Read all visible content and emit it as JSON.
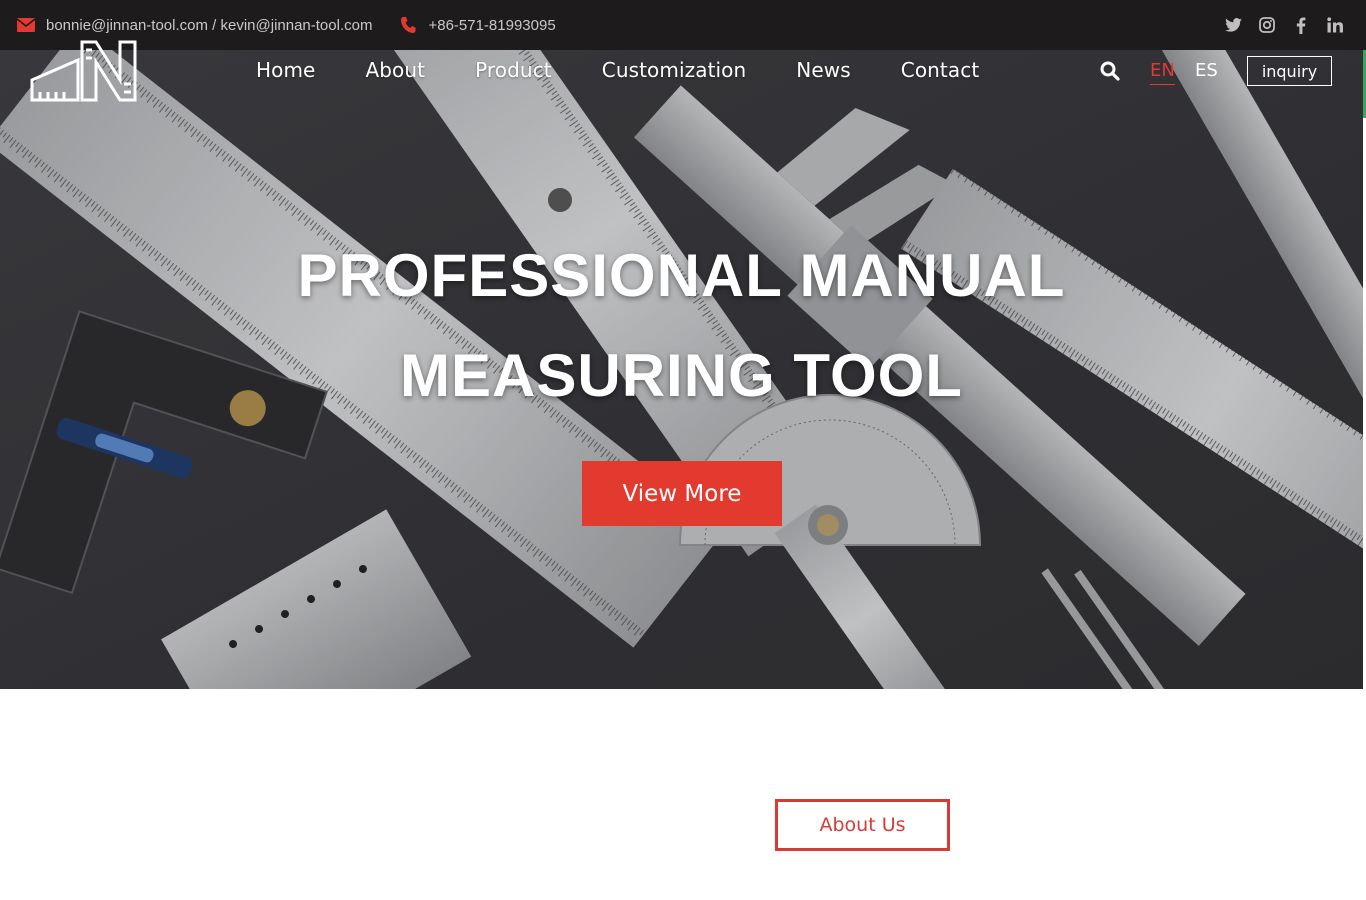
{
  "topbar": {
    "email": "bonnie@jinnan-tool.com / kevin@jinnan-tool.com",
    "phone": "+86-571-81993095",
    "icons": [
      "mail-icon",
      "phone-icon"
    ],
    "social": [
      "twitter-icon",
      "instagram-icon",
      "facebook-icon",
      "linkedin-icon"
    ]
  },
  "nav": {
    "items": [
      "Home",
      "About",
      "Product",
      "Customization",
      "News",
      "Contact"
    ],
    "lang_en": "EN",
    "lang_es": "ES",
    "inquiry": "inquiry"
  },
  "hero": {
    "title_line1": "PROFESSIONAL MANUAL",
    "title_line2": "MEASURING TOOL",
    "cta": "View More"
  },
  "about": {
    "button": "About Us"
  },
  "colors": {
    "accent": "#e23a2e",
    "topbar_bg": "#1d1b1b",
    "hero_bg": "#37373b"
  }
}
